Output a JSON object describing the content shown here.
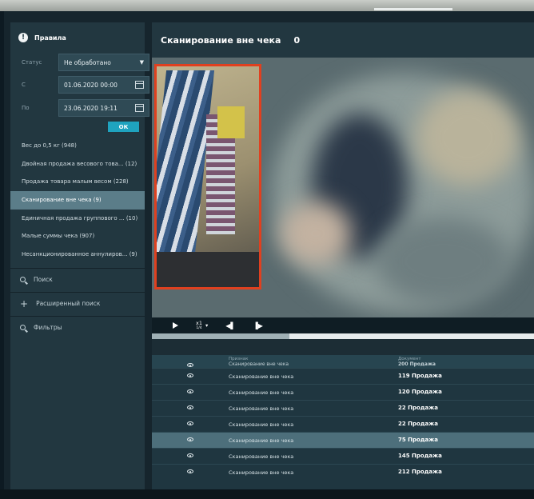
{
  "sidebar": {
    "title": "Правила",
    "status_label": "Статус",
    "status_value": "Не обработано",
    "from_label": "С",
    "from_value": "01.06.2020 00:00",
    "to_label": "По",
    "to_value": "23.06.2020 19:11",
    "ok_label": "ОК",
    "rules": [
      {
        "label": "Вес до 0,5 кг (948)",
        "active": false
      },
      {
        "label": "Двойная продажа весового това... (12)",
        "active": false
      },
      {
        "label": "Продажа товара малым весом (228)",
        "active": false
      },
      {
        "label": "Сканирование вне чека (9)",
        "active": true
      },
      {
        "label": "Единичная продажа группового ... (10)",
        "active": false
      },
      {
        "label": "Малые суммы чека (907)",
        "active": false
      },
      {
        "label": "Несанкционированное аннулиров... (9)",
        "active": false
      }
    ],
    "search_label": "Поиск",
    "advanced_search_label": "Расширенный поиск",
    "filters_label": "Фильтры"
  },
  "main": {
    "title": "Сканирование вне чека",
    "count": "0"
  },
  "player": {
    "speed_top": "x1",
    "speed_bottom": "1/4",
    "progress": 0.36
  },
  "table": {
    "columns": [
      "Признак",
      "Документ"
    ],
    "partial_row": {
      "type": "Сканирование вне чека",
      "doc": "200 Продажа"
    },
    "rows": [
      {
        "type": "Сканирование вне чека",
        "doc": "119 Продажа",
        "selected": false
      },
      {
        "type": "Сканирование вне чека",
        "doc": "120 Продажа",
        "selected": false
      },
      {
        "type": "Сканирование вне чека",
        "doc": "22 Продажа",
        "selected": false
      },
      {
        "type": "Сканирование вне чека",
        "doc": "22 Продажа",
        "selected": false
      },
      {
        "type": "Сканирование вне чека",
        "doc": "75 Продажа",
        "selected": true
      },
      {
        "type": "Сканирование вне чека",
        "doc": "145 Продажа",
        "selected": false
      },
      {
        "type": "Сканирование вне чека",
        "doc": "212 Продажа",
        "selected": false
      }
    ]
  },
  "colors": {
    "accent": "#1fa3bf",
    "highlight_box": "#e0401f",
    "selected_row": "#4d6f7b"
  }
}
